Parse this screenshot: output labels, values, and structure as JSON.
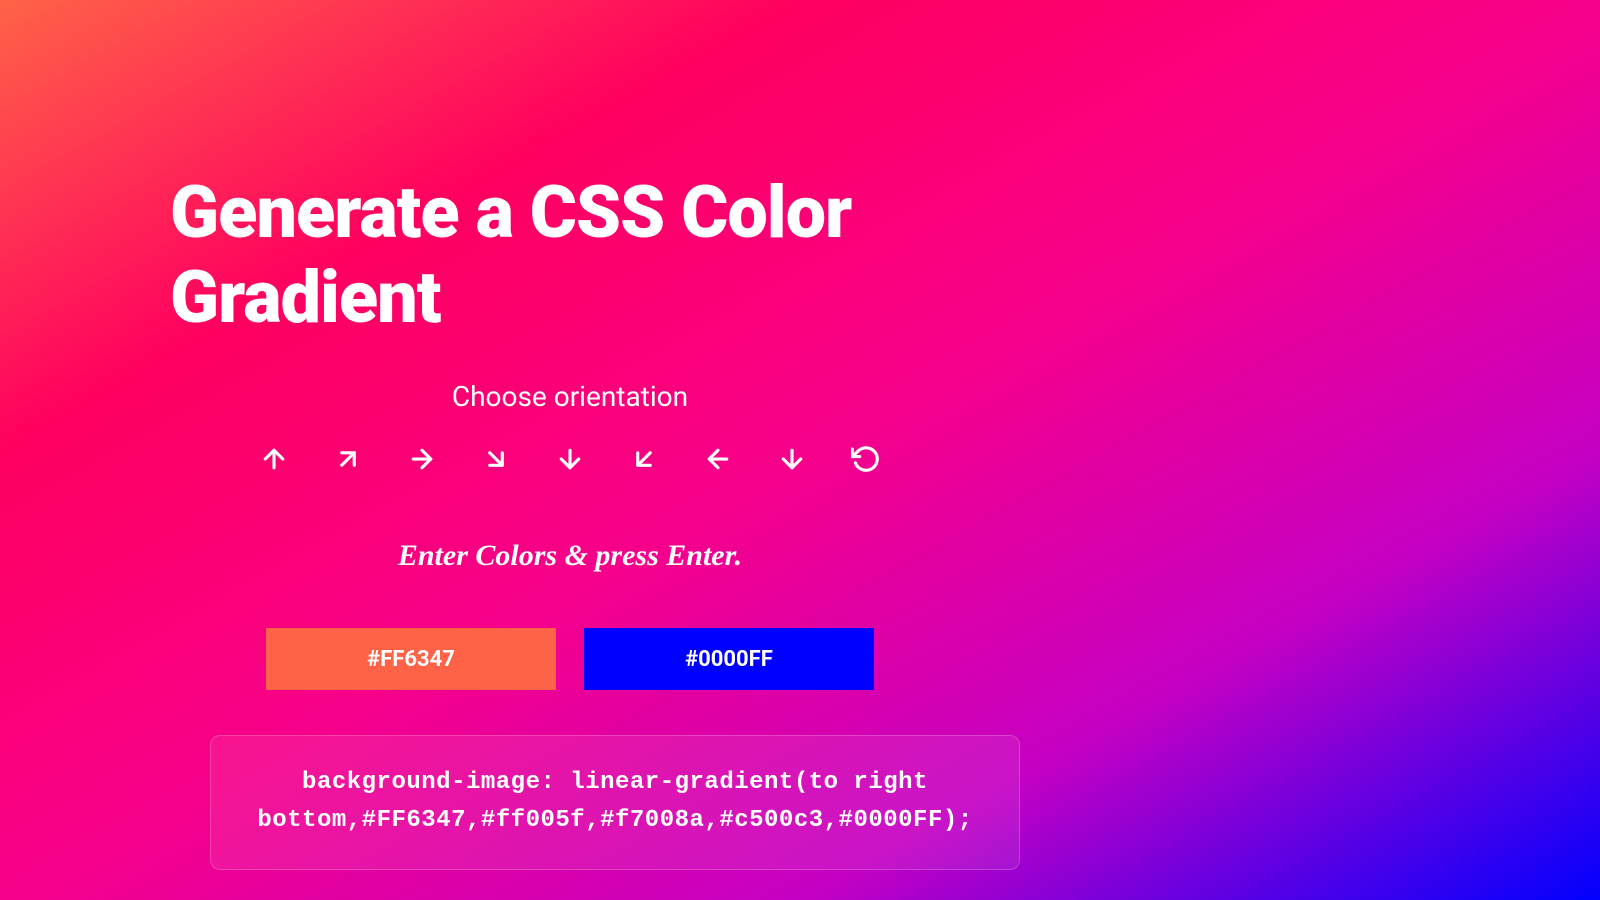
{
  "header": {
    "title": "Generate a CSS Color Gradient",
    "subtitle": "Choose orientation"
  },
  "orientations": {
    "up": "arrow-up",
    "upRight": "arrow-up-right",
    "right": "arrow-right",
    "downRight": "arrow-down-right",
    "down": "arrow-down",
    "downLeft": "arrow-down-left",
    "left": "arrow-left",
    "down2": "arrow-down",
    "radial": "rotate"
  },
  "instruction": "Enter Colors & press Enter.",
  "colors": {
    "color1": "#FF6347",
    "color2": "#0000FF"
  },
  "output": {
    "code": "background-image: linear-gradient(to right bottom,#FF6347,#ff005f,#f7008a,#c500c3,#0000FF);"
  }
}
